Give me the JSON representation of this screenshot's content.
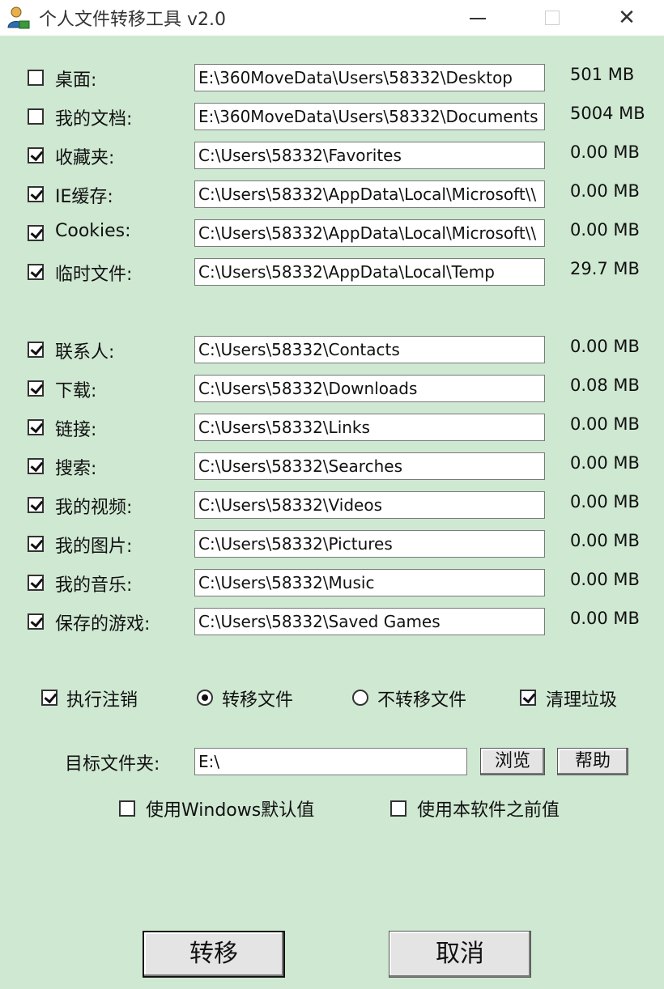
{
  "window": {
    "title": "个人文件转移工具 v2.0",
    "controls": {
      "minimize": "—",
      "maximize": "☐",
      "close": "✕"
    }
  },
  "folders_group1": [
    {
      "label": "桌面:",
      "checked": false,
      "path": "E:\\360MoveData\\Users\\58332\\Desktop",
      "size": "501  MB"
    },
    {
      "label": "我的文档:",
      "checked": false,
      "path": "E:\\360MoveData\\Users\\58332\\Documents",
      "size": "5004 MB"
    },
    {
      "label": "收藏夹:",
      "checked": true,
      "path": "C:\\Users\\58332\\Favorites",
      "size": "0.00 MB"
    },
    {
      "label": "IE缓存:",
      "checked": true,
      "path": "C:\\Users\\58332\\AppData\\Local\\Microsoft\\\\",
      "size": "0.00 MB"
    },
    {
      "label": "Cookies:",
      "checked": true,
      "path": "C:\\Users\\58332\\AppData\\Local\\Microsoft\\\\",
      "size": "0.00 MB"
    },
    {
      "label": "临时文件:",
      "checked": true,
      "path": "C:\\Users\\58332\\AppData\\Local\\Temp",
      "size": "29.7 MB"
    }
  ],
  "folders_group2": [
    {
      "label": "联系人:",
      "checked": true,
      "path": "C:\\Users\\58332\\Contacts",
      "size": "0.00 MB"
    },
    {
      "label": "下载:",
      "checked": true,
      "path": "C:\\Users\\58332\\Downloads",
      "size": "0.08 MB"
    },
    {
      "label": "链接:",
      "checked": true,
      "path": "C:\\Users\\58332\\Links",
      "size": "0.00 MB"
    },
    {
      "label": "搜索:",
      "checked": true,
      "path": "C:\\Users\\58332\\Searches",
      "size": "0.00 MB"
    },
    {
      "label": "我的视频:",
      "checked": true,
      "path": "C:\\Users\\58332\\Videos",
      "size": "0.00 MB"
    },
    {
      "label": "我的图片:",
      "checked": true,
      "path": "C:\\Users\\58332\\Pictures",
      "size": "0.00 MB"
    },
    {
      "label": "我的音乐:",
      "checked": true,
      "path": "C:\\Users\\58332\\Music",
      "size": "0.00 MB"
    },
    {
      "label": "保存的游戏:",
      "checked": true,
      "path": "C:\\Users\\58332\\Saved Games",
      "size": "0.00 MB"
    }
  ],
  "options": {
    "execute_logoff": {
      "label": "执行注销",
      "checked": true
    },
    "transfer_files": {
      "label": "转移文件",
      "selected": true
    },
    "no_transfer_files": {
      "label": "不转移文件",
      "selected": false
    },
    "clean_junk": {
      "label": "清理垃圾",
      "checked": true
    }
  },
  "target": {
    "label": "目标文件夹:",
    "value": "E:\\",
    "browse_label": "浏览",
    "help_label": "帮助"
  },
  "defaults": {
    "use_windows_default": {
      "label": "使用Windows默认值",
      "checked": false
    },
    "use_previous": {
      "label": "使用本软件之前值",
      "checked": false
    }
  },
  "actions": {
    "transfer_label": "转移",
    "cancel_label": "取消"
  },
  "colors": {
    "background": "#cfe8d2",
    "titlebar": "#ffffff"
  }
}
